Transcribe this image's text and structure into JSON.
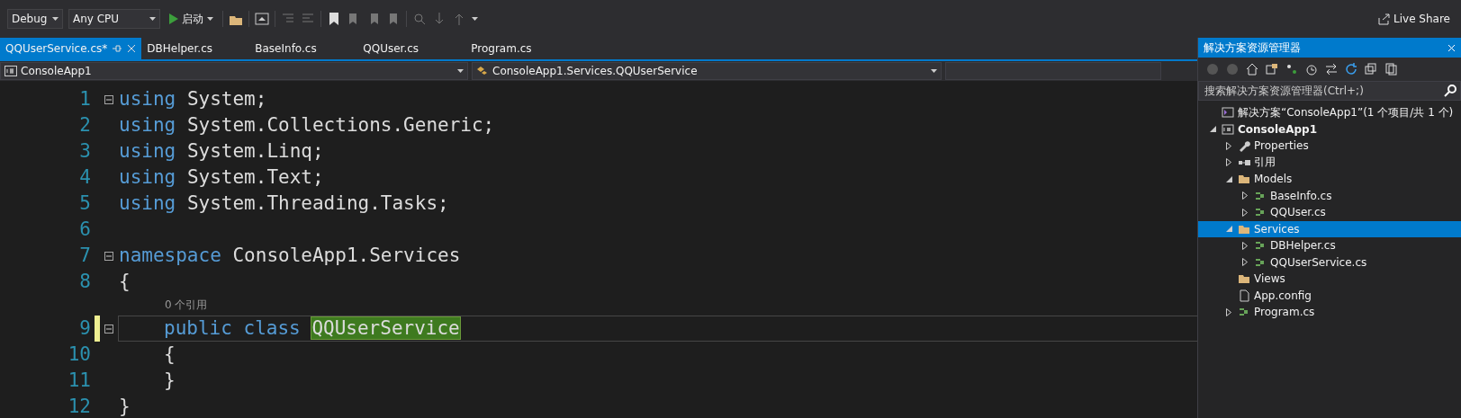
{
  "toolbar": {
    "configuration": "Debug",
    "platform": "Any CPU",
    "start_button": "启动",
    "live_share": "Live Share"
  },
  "tabs": [
    {
      "label": "QQUserService.cs*",
      "selected": true
    },
    {
      "label": "DBHelper.cs",
      "selected": false
    },
    {
      "label": "BaseInfo.cs",
      "selected": false
    },
    {
      "label": "QQUser.cs",
      "selected": false
    },
    {
      "label": "Program.cs",
      "selected": false
    }
  ],
  "nav_bar": {
    "project": "ConsoleApp1",
    "type": "ConsoleApp1.Services.QQUserService"
  },
  "editor": {
    "lines": [
      {
        "number": "1",
        "fold": true,
        "modified": false,
        "current": false,
        "tokens": [
          {
            "text": "using",
            "kind": "keyword"
          },
          {
            "text": "System;",
            "kind": "plain"
          }
        ]
      },
      {
        "number": "2",
        "fold": false,
        "modified": false,
        "current": false,
        "tokens": [
          {
            "text": "using",
            "kind": "keyword"
          },
          {
            "text": "System.Collections.Generic;",
            "kind": "plain"
          }
        ]
      },
      {
        "number": "3",
        "fold": false,
        "modified": false,
        "current": false,
        "tokens": [
          {
            "text": "using",
            "kind": "keyword"
          },
          {
            "text": "System.Linq;",
            "kind": "plain"
          }
        ]
      },
      {
        "number": "4",
        "fold": false,
        "modified": false,
        "current": false,
        "tokens": [
          {
            "text": "using",
            "kind": "keyword"
          },
          {
            "text": "System.Text;",
            "kind": "plain"
          }
        ]
      },
      {
        "number": "5",
        "fold": false,
        "modified": false,
        "current": false,
        "tokens": [
          {
            "text": "using",
            "kind": "keyword"
          },
          {
            "text": "System.Threading.Tasks;",
            "kind": "plain"
          }
        ]
      },
      {
        "number": "6",
        "fold": false,
        "modified": false,
        "current": false
      },
      {
        "number": "7",
        "fold": true,
        "modified": false,
        "current": false,
        "tokens": [
          {
            "text": "namespace",
            "kind": "keyword"
          },
          {
            "text": "ConsoleApp1.Services",
            "kind": "plain"
          }
        ]
      },
      {
        "number": "8",
        "fold": false,
        "modified": false,
        "current": false,
        "tokens": [
          {
            "text": "{",
            "kind": "plain"
          }
        ]
      },
      {
        "number": "9",
        "fold": true,
        "modified": true,
        "current": true,
        "codelens": "0 个引用",
        "indented": true,
        "tokens": [
          {
            "text": "public",
            "kind": "keyword"
          },
          {
            "text": "class",
            "kind": "keyword"
          },
          {
            "text": "QQUserService",
            "kind": "highlight"
          }
        ]
      },
      {
        "number": "10",
        "fold": false,
        "modified": false,
        "current": false,
        "indented": true,
        "tokens": [
          {
            "text": "{",
            "kind": "plain"
          }
        ]
      },
      {
        "number": "11",
        "fold": false,
        "modified": false,
        "current": false,
        "indented": true,
        "tokens": [
          {
            "text": "}",
            "kind": "plain"
          }
        ]
      },
      {
        "number": "12",
        "fold": false,
        "modified": false,
        "current": false,
        "tokens": [
          {
            "text": "}",
            "kind": "plain"
          }
        ]
      }
    ]
  },
  "solution_explorer": {
    "title": "解决方案资源管理器",
    "search": {
      "placeholder": "搜索解决方案资源管理器(Ctrl+;)"
    },
    "tree": [
      {
        "label": "解决方案“ConsoleApp1”(1 个项目/共 1 个)",
        "kind": "solution",
        "selected": false,
        "children": [
          {
            "label": "ConsoleApp1",
            "kind": "project",
            "expanded": true,
            "selected": false,
            "children": [
              {
                "label": "Properties",
                "kind": "properties",
                "expanded": false,
                "selected": false
              },
              {
                "label": "引用",
                "kind": "references",
                "expanded": false,
                "selected": false
              },
              {
                "label": "Models",
                "kind": "folder",
                "expanded": true,
                "selected": false,
                "children": [
                  {
                    "label": "BaseInfo.cs",
                    "kind": "csharp",
                    "expanded": false,
                    "selected": false
                  },
                  {
                    "label": "QQUser.cs",
                    "kind": "csharp",
                    "expanded": false,
                    "selected": false
                  }
                ]
              },
              {
                "label": "Services",
                "kind": "folder",
                "expanded": true,
                "selected": true,
                "children": [
                  {
                    "label": "DBHelper.cs",
                    "kind": "csharp",
                    "expanded": false,
                    "selected": false
                  },
                  {
                    "label": "QQUserService.cs",
                    "kind": "csharp",
                    "expanded": false,
                    "selected": false
                  }
                ]
              },
              {
                "label": "Views",
                "kind": "folder",
                "selected": false
              },
              {
                "label": "App.config",
                "kind": "config",
                "selected": false
              },
              {
                "label": "Program.cs",
                "kind": "csharp",
                "expanded": false,
                "selected": false
              }
            ]
          }
        ]
      }
    ]
  }
}
